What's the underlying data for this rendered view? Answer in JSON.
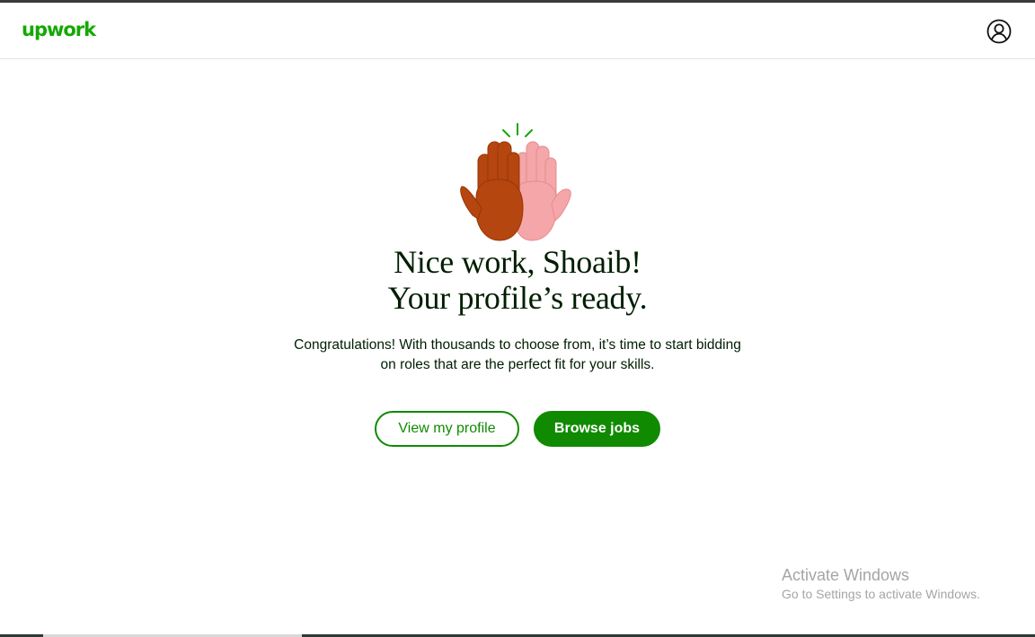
{
  "header": {
    "logo_text": "upwork",
    "account_icon": "user-circle-icon"
  },
  "hero": {
    "illustration": "high-five-icon"
  },
  "headline": {
    "line1": "Nice work, Shoaib!",
    "line2": "Your profile’s ready."
  },
  "message": {
    "line1": "Congratulations! With thousands to choose from, it’s time to start bidding",
    "line2": "on roles that are the perfect fit for your skills."
  },
  "actions": {
    "view_profile_label": "View my profile",
    "browse_jobs_label": "Browse jobs"
  },
  "watermark": {
    "title": "Activate Windows",
    "subtitle": "Go to Settings to activate Windows."
  },
  "colors": {
    "brand_green": "#14a800",
    "button_green": "#108a00",
    "text_dark": "#001e00"
  }
}
